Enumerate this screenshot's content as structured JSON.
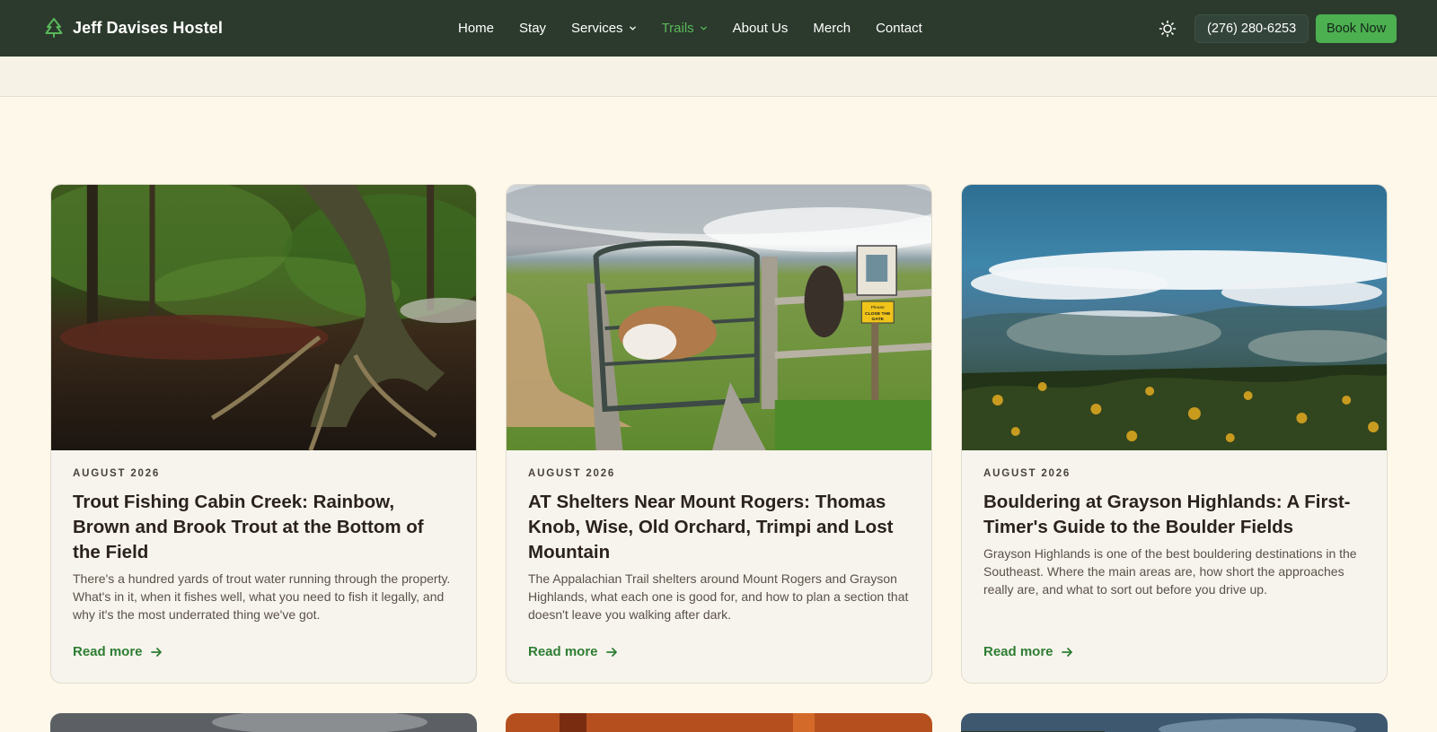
{
  "header": {
    "brand_name": "Jeff Davises Hostel",
    "brand_icon": "tree-icon",
    "nav": [
      {
        "label": "Home",
        "has_dropdown": false,
        "active": false
      },
      {
        "label": "Stay",
        "has_dropdown": false,
        "active": false
      },
      {
        "label": "Services",
        "has_dropdown": true,
        "active": false
      },
      {
        "label": "Trails",
        "has_dropdown": true,
        "active": true
      },
      {
        "label": "About Us",
        "has_dropdown": false,
        "active": false
      },
      {
        "label": "Merch",
        "has_dropdown": false,
        "active": false
      },
      {
        "label": "Contact",
        "has_dropdown": false,
        "active": false
      }
    ],
    "theme_icon": "sun-icon",
    "phone": "(276) 280-6253",
    "book_label": "Book Now"
  },
  "colors": {
    "header_bg": "#2b3a2c",
    "accent": "#4caf50",
    "active_nav": "#5ab85a",
    "link": "#2e7d32",
    "page_bg": "#fdf8e9",
    "card_bg": "#f7f4ee"
  },
  "posts": [
    {
      "date": "AUGUST 2026",
      "title": "Trout Fishing Cabin Creek: Rainbow, Brown and Brook Trout at the Bottom of the Field",
      "excerpt": "There's a hundred yards of trout water running through the property. What's in it, when it fishes well, what you need to fish it legally, and why it's the most underrated thing we've got.",
      "read_more": "Read more",
      "image": "forest-creek-roots-photo"
    },
    {
      "date": "AUGUST 2026",
      "title": "AT Shelters Near Mount Rogers: Thomas Knob, Wise, Old Orchard, Trimpi and Lost Mountain",
      "excerpt": "The Appalachian Trail shelters around Mount Rogers and Grayson Highlands, what each one is good for, and how to plan a section that doesn't leave you walking after dark.",
      "read_more": "Read more",
      "image": "ponies-at-gate-photo",
      "sign_text": [
        "Please",
        "CLOSE THE",
        "GATE"
      ]
    },
    {
      "date": "AUGUST 2026",
      "title": "Bouldering at Grayson Highlands: A First-Timer's Guide to the Boulder Fields",
      "excerpt": "Grayson Highlands is one of the best bouldering destinations in the Southeast. Where the main areas are, how short the approaches really are, and what to sort out before you drive up.",
      "read_more": "Read more",
      "image": "clouds-over-mountains-photo"
    }
  ]
}
